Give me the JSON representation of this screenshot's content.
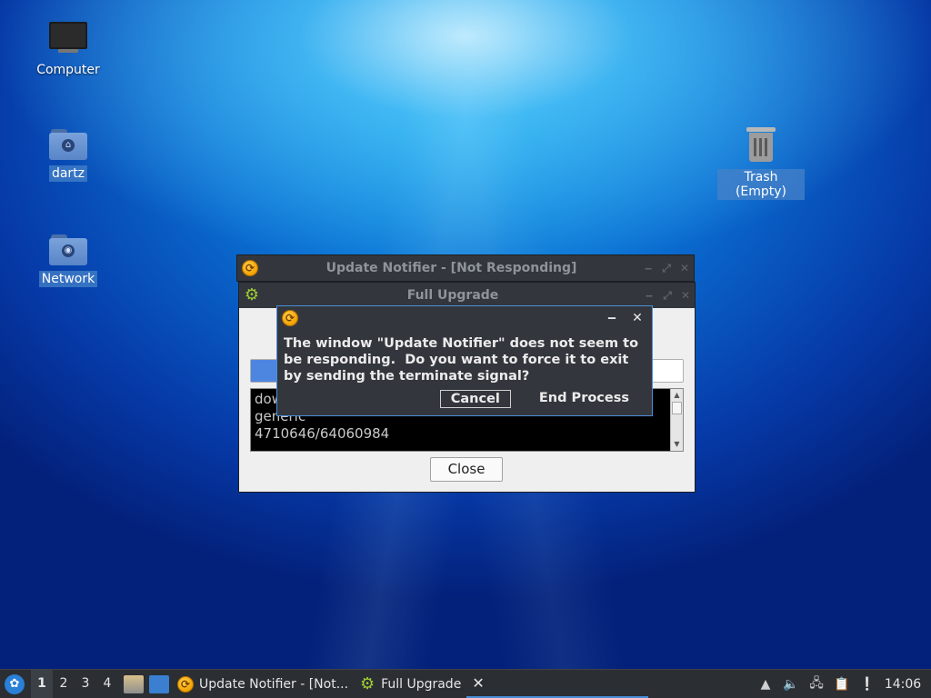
{
  "desktop": {
    "icons": [
      {
        "label": "Computer"
      },
      {
        "label": "dartz"
      },
      {
        "label": "Network"
      },
      {
        "label": "Trash (Empty)"
      }
    ]
  },
  "windows": {
    "notifier": {
      "title": "Update Notifier - [Not Responding]",
      "min": "‒",
      "max": "⤢",
      "close": "✕"
    },
    "upgrade": {
      "title": "Full Upgrade",
      "min": "‒",
      "max": "⤢",
      "close": "✕",
      "console_lines": [
        "dow",
        "generic",
        "4710646/64060984"
      ],
      "close_button": "Close",
      "progress_fraction": 0.07
    }
  },
  "dialog": {
    "message": "The window \"Update Notifier\" does not seem to\nbe responding.  Do you want to force it to exit\nby sending the terminate signal?",
    "cancel": "Cancel",
    "end_process": "End Process",
    "min": "‒",
    "close": "✕"
  },
  "taskbar": {
    "workspaces": [
      "1",
      "2",
      "3",
      "4"
    ],
    "tasks": [
      "Update Notifier - [Not...",
      "Full Upgrade"
    ],
    "close_glyph": "✕",
    "clock": "14:06"
  },
  "colors": {
    "accent": "#4a8ed8",
    "progress": "#4c86e0"
  }
}
